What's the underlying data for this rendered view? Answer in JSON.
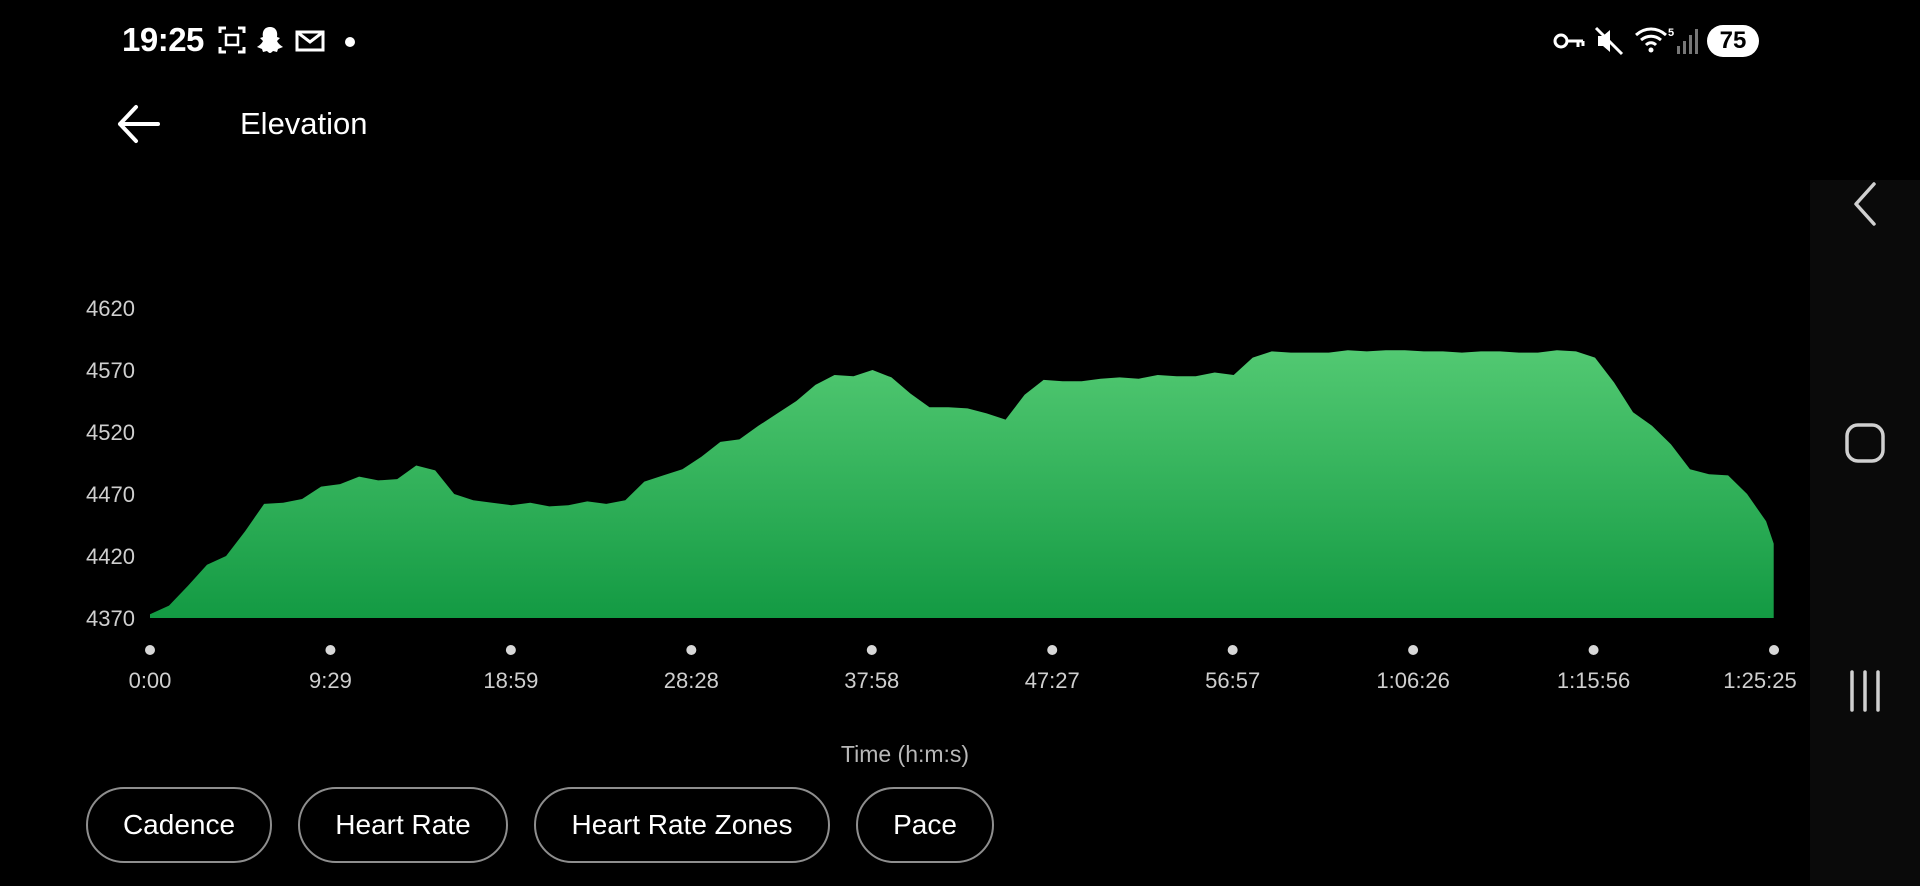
{
  "status_bar": {
    "time": "19:25",
    "battery": "75",
    "wifi_badge": "5",
    "left_icons": [
      "screenshot-icon",
      "snapchat-icon",
      "gmail-icon",
      "notification-dot-icon"
    ],
    "right_icons": [
      "vpn-key-icon",
      "mute-icon",
      "wifi-icon",
      "signal-icon",
      "battery-icon"
    ]
  },
  "header": {
    "title": "Elevation"
  },
  "chart_data": {
    "type": "area",
    "title": "",
    "xlabel": "Time (h:m:s)",
    "ylabel": "",
    "color": "#1fae4f",
    "color_top": "#52c972",
    "color_bottom": "#139a43",
    "ylim": [
      4370,
      4620
    ],
    "y_ticks": [
      4620,
      4570,
      4520,
      4470,
      4420,
      4370
    ],
    "xlim_seconds": [
      0,
      5125
    ],
    "x_tick_labels": [
      "0:00",
      "9:29",
      "18:59",
      "28:28",
      "37:58",
      "47:27",
      "56:57",
      "1:06:26",
      "1:15:56",
      "1:25:25"
    ],
    "x_minutes": [
      0,
      1,
      2,
      3,
      4,
      5,
      6,
      7,
      8,
      9,
      10,
      11,
      12,
      13,
      14,
      15,
      16,
      17,
      18,
      19,
      20,
      21,
      22,
      23,
      24,
      25,
      26,
      27,
      28,
      29,
      30,
      31,
      32,
      33,
      34,
      35,
      36,
      37,
      38,
      39,
      40,
      41,
      42,
      43,
      44,
      45,
      46,
      47,
      48,
      49,
      50,
      51,
      52,
      53,
      54,
      55,
      56,
      57,
      58,
      59,
      60,
      61,
      62,
      63,
      64,
      65,
      66,
      67,
      68,
      69,
      70,
      71,
      72,
      73,
      74,
      75,
      76,
      77,
      78,
      79,
      80,
      81,
      82,
      83,
      84,
      85,
      85.4
    ],
    "elevation_m": [
      4373,
      4380,
      4396,
      4413,
      4420,
      4440,
      4462,
      4463,
      4466,
      4476,
      4478,
      4484,
      4481,
      4482,
      4493,
      4489,
      4470,
      4465,
      4463,
      4461,
      4463,
      4460,
      4461,
      4464,
      4462,
      4465,
      4480,
      4485,
      4490,
      4500,
      4512,
      4514,
      4525,
      4535,
      4545,
      4558,
      4566,
      4565,
      4570,
      4564,
      4551,
      4540,
      4540,
      4539,
      4535,
      4530,
      4550,
      4562,
      4561,
      4561,
      4563,
      4564,
      4563,
      4566,
      4565,
      4565,
      4568,
      4566,
      4580,
      4585,
      4584,
      4584,
      4584,
      4586,
      4585,
      4586,
      4586,
      4585,
      4585,
      4584,
      4585,
      4585,
      4584,
      4584,
      4586,
      4585,
      4580,
      4560,
      4536,
      4525,
      4510,
      4490,
      4486,
      4485,
      4470,
      4448,
      4430,
      4409,
      4400
    ]
  },
  "metric_buttons": [
    {
      "label": "Cadence"
    },
    {
      "label": "Heart Rate"
    },
    {
      "label": "Heart Rate Zones"
    },
    {
      "label": "Pace"
    }
  ]
}
